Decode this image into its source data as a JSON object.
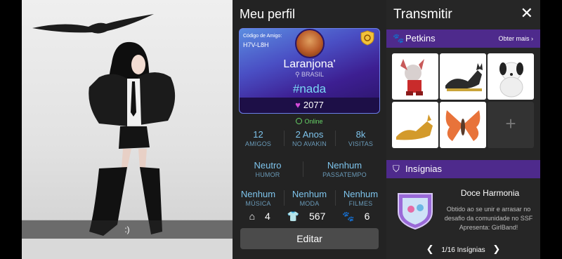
{
  "viewport": {
    "caption": ":)"
  },
  "profile": {
    "title": "Meu perfil",
    "friend_code_label": "Código de Amigo:",
    "friend_code": "H7V-L8H",
    "username": "Laranjona'",
    "country": "BRASIL",
    "hashtag": "#nada",
    "likes": "2077",
    "status": "Online",
    "stats_row1": [
      {
        "value": "12",
        "label": "AMIGOS"
      },
      {
        "value": "2 Anos",
        "label": "NO AVAKIN"
      },
      {
        "value": "8k",
        "label": "VISITAS"
      }
    ],
    "stats_row2": [
      {
        "value": "Neutro",
        "label": "HUMOR"
      },
      {
        "value": "Nenhum",
        "label": "PASSATEMPO"
      }
    ],
    "stats_row3": [
      {
        "value": "Nenhum",
        "label": "MÚSICA"
      },
      {
        "value": "Nenhum",
        "label": "MODA"
      },
      {
        "value": "Nenhum",
        "label": "FILMES"
      }
    ],
    "counts": {
      "homes": "4",
      "outfits": "567",
      "pets": "6"
    },
    "edit_label": "Editar"
  },
  "side": {
    "title": "Transmitir",
    "close": "✕",
    "petkins_label": "Petkins",
    "petkins_more": "Obter mais",
    "insignias_label": "Insígnias",
    "badge_title": "Doce Harmonia",
    "badge_desc": "Obtido ao se unir e arrasar no desafio da comunidade no SSF Apresenta: GirlBand!",
    "pager": "1/16 Insígnias"
  },
  "colors": {
    "accent_purple": "#4e2a8c",
    "stat_blue": "#7ec4ec",
    "online_green": "#67d468"
  }
}
